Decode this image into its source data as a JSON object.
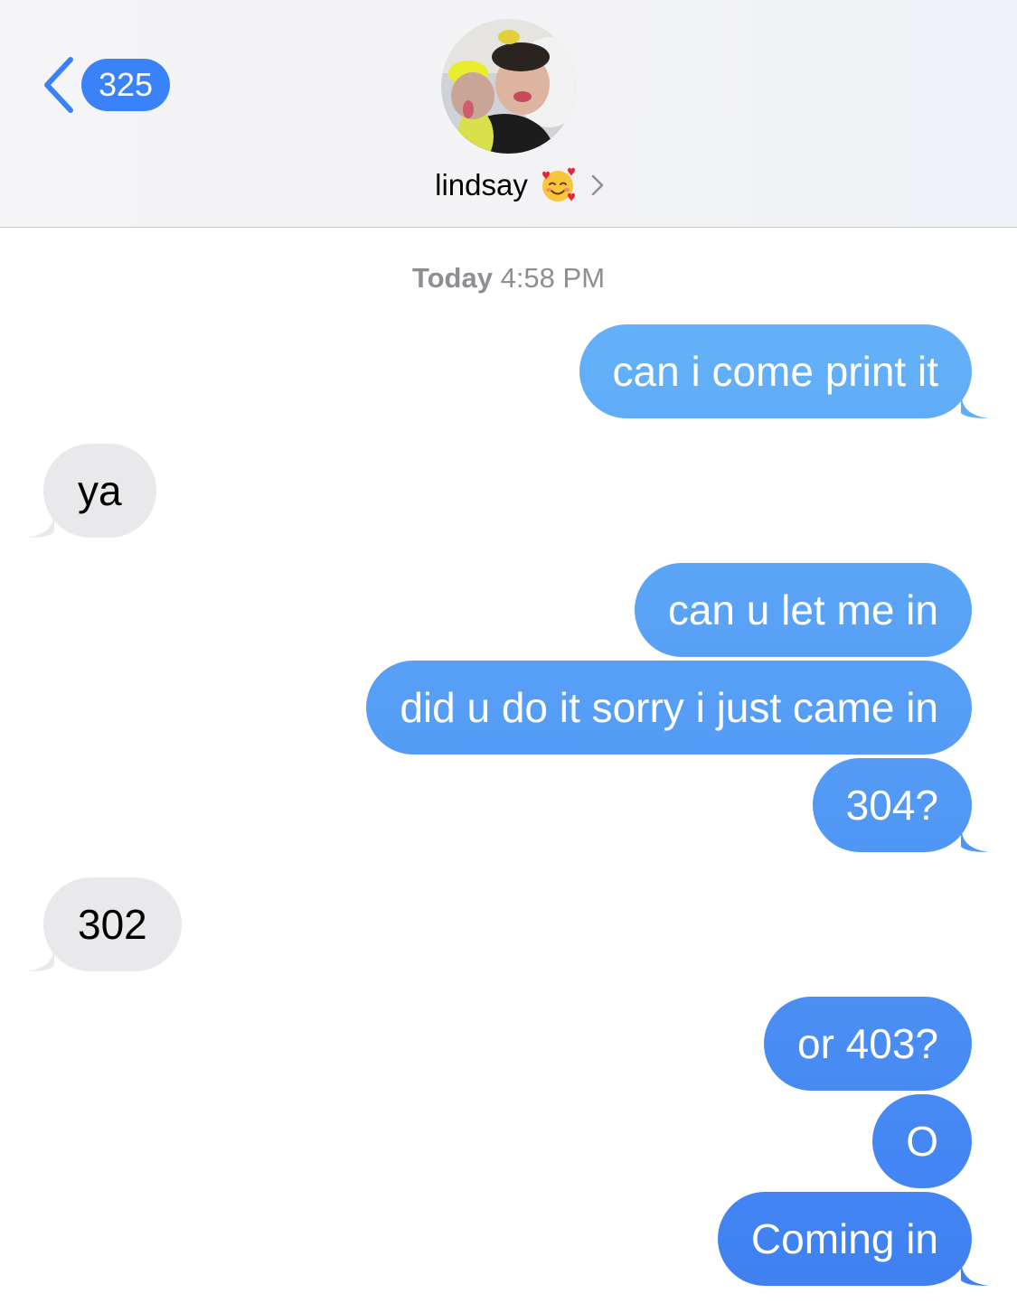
{
  "header": {
    "back_count": "325",
    "contact_name": "lindsay",
    "contact_emoji_icon": "smiling-face-with-hearts-icon",
    "chevron_icon": "chevron-right-icon",
    "back_icon": "chevron-left-icon"
  },
  "thread": {
    "timestamp_day": "Today",
    "timestamp_time": "4:58 PM"
  },
  "messages": [
    {
      "direction": "sent",
      "text": "can i come print it"
    },
    {
      "direction": "received",
      "text": "ya"
    },
    {
      "direction": "sent",
      "text": "can u let me in"
    },
    {
      "direction": "sent",
      "text": "did u do it sorry i just came in"
    },
    {
      "direction": "sent",
      "text": "304?"
    },
    {
      "direction": "received",
      "text": "302"
    },
    {
      "direction": "sent",
      "text": "or 403?"
    },
    {
      "direction": "sent",
      "text": "O"
    },
    {
      "direction": "sent",
      "text": "Coming in"
    }
  ],
  "colors": {
    "sent_top": "#65b2f8",
    "sent_bottom": "#3f7ff2",
    "received": "#e9e9eb",
    "accent": "#3a82f7"
  }
}
